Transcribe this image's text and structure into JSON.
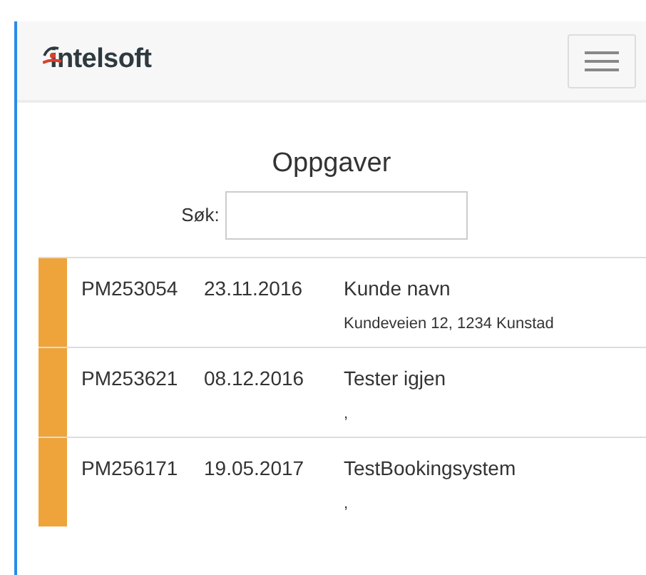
{
  "navbar": {
    "logo": "intelsoft"
  },
  "title": "Oppgaver",
  "search": {
    "label": "Søk:"
  },
  "tasks": [
    {
      "id": "PM253054",
      "date": "23.11.2016",
      "name": "Kunde navn",
      "address": "Kundeveien 12, 1234 Kunstad",
      "color": "#eea43a"
    },
    {
      "id": "PM253621",
      "date": "08.12.2016",
      "name": "Tester igjen",
      "address": ",",
      "color": "#eea43a"
    },
    {
      "id": "PM256171",
      "date": "19.05.2017",
      "name": "TestBookingsystem",
      "address": ",",
      "color": "#eea43a"
    }
  ]
}
